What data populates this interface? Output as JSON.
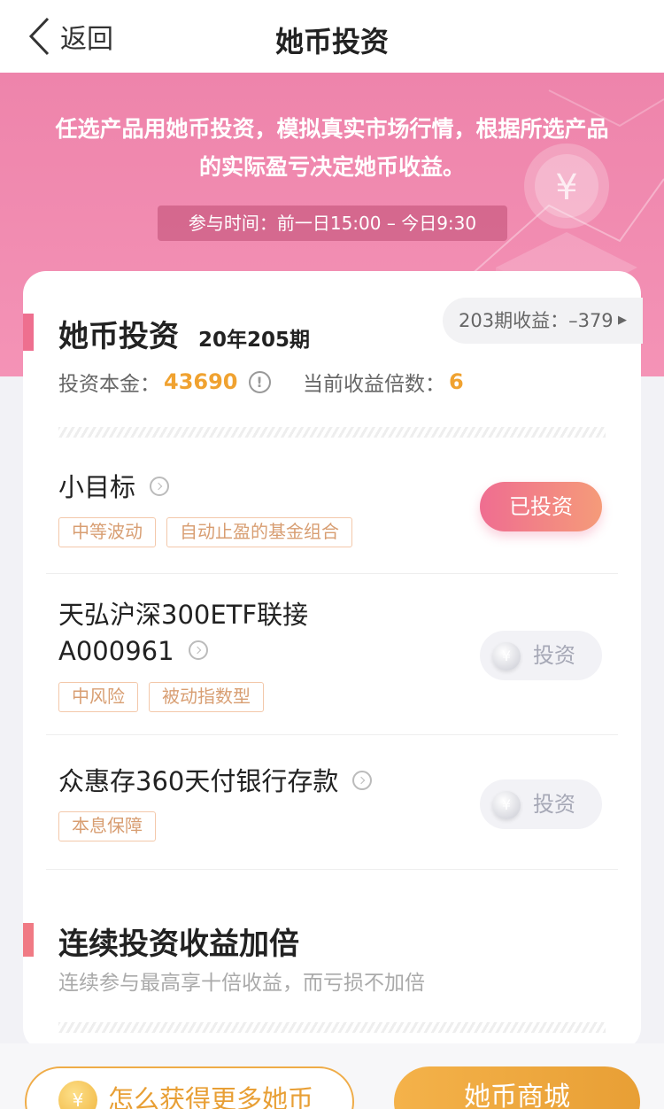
{
  "nav": {
    "back_label": "返回",
    "title": "她币投资"
  },
  "banner": {
    "description": "任选产品用她币投资，模拟真实市场行情，根据所选产品的实际盈亏决定她币收益。",
    "time_label": "参与时间：前一日15:00 – 今日9:30",
    "coin_symbol": "¥"
  },
  "investment": {
    "title": "她币投资",
    "period": "20年205期",
    "last_gain": "203期收益：–379",
    "principal_label": "投资本金：",
    "principal_value": "43690",
    "multiplier_label": "当前收益倍数：",
    "multiplier_value": "6"
  },
  "products": [
    {
      "name": "小目标",
      "tags": [
        "中等波动",
        "自动止盈的基金组合"
      ],
      "button": "已投资"
    },
    {
      "name_line1": "天弘沪深300ETF联接",
      "name_line2": "A000961",
      "tags": [
        "中风险",
        "被动指数型"
      ],
      "button": "投资"
    },
    {
      "name": "众惠存360天付银行存款",
      "tags": [
        "本息保障"
      ],
      "button": "投资"
    }
  ],
  "bonus": {
    "title": "连续投资收益加倍",
    "subtitle": "连续参与最高享十倍收益，而亏损不加倍"
  },
  "bottom": {
    "more_label": "怎么获得更多她币",
    "mall_label": "她币商城",
    "coin_symbol": "¥"
  },
  "colors": {
    "accent_pink": "#ee6f8f",
    "banner_pink": "#ee84ab",
    "gold": "#f0a230"
  }
}
